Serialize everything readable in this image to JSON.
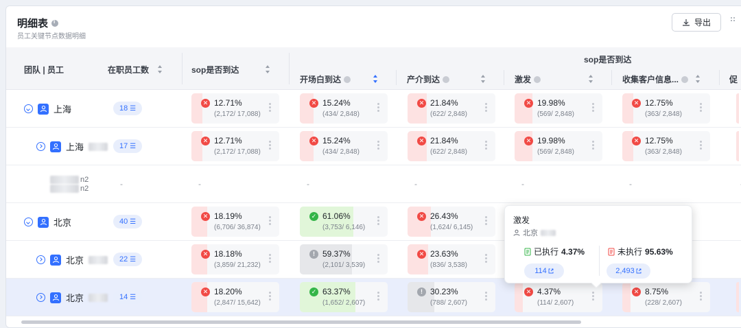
{
  "header": {
    "title": "明细表",
    "subtitle": "员工关键节点数据明细",
    "export_label": "导出"
  },
  "columns": {
    "team": "团队 | 员工",
    "employees": "在职员工数",
    "sop_arrival": "sop是否到达",
    "group_title": "sop是否到达",
    "opening": "开场白到达",
    "product": "产介到达",
    "motivate": "激发",
    "collect": "收集客户信息...",
    "cut": "促"
  },
  "rows": [
    {
      "team": "上海",
      "emp": "18",
      "level": 0,
      "metrics": [
        {
          "pct": "12.71%",
          "frac": "(2,172/ 17,088)",
          "status": "fail",
          "value": 0.1271
        },
        {
          "pct": "15.24%",
          "frac": "(434/ 2,848)",
          "status": "fail",
          "value": 0.1524
        },
        {
          "pct": "21.84%",
          "frac": "(622/ 2,848)",
          "status": "fail",
          "value": 0.2184
        },
        {
          "pct": "19.98%",
          "frac": "(569/ 2,848)",
          "status": "fail",
          "value": 0.1998
        },
        {
          "pct": "12.75%",
          "frac": "(363/ 2,848)",
          "status": "fail",
          "value": 0.1275
        }
      ]
    },
    {
      "team": "上海",
      "emp": "17",
      "level": 1,
      "metrics": [
        {
          "pct": "12.71%",
          "frac": "(2,172/ 17,088)",
          "status": "fail",
          "value": 0.1271
        },
        {
          "pct": "15.24%",
          "frac": "(434/ 2,848)",
          "status": "fail",
          "value": 0.1524
        },
        {
          "pct": "21.84%",
          "frac": "(622/ 2,848)",
          "status": "fail",
          "value": 0.2184
        },
        {
          "pct": "19.98%",
          "frac": "(569/ 2,848)",
          "status": "fail",
          "value": 0.1998
        },
        {
          "pct": "12.75%",
          "frac": "(363/ 2,848)",
          "status": "fail",
          "value": 0.1275
        }
      ]
    },
    {
      "team": "",
      "line1": "n2",
      "line2": "n2",
      "emp": "-",
      "level": 2,
      "dash": "-"
    },
    {
      "team": "北京",
      "emp": "40",
      "level": 0,
      "metrics": [
        {
          "pct": "18.19%",
          "frac": "(6,706/ 36,874)",
          "status": "fail",
          "value": 0.1819
        },
        {
          "pct": "61.06%",
          "frac": "(3,753/ 6,146)",
          "status": "pass",
          "value": 0.6106
        },
        {
          "pct": "26.43%",
          "frac": "(1,624/ 6,145)",
          "status": "fail",
          "value": 0.2643
        }
      ]
    },
    {
      "team": "北京",
      "emp": "22",
      "level": 1,
      "metrics": [
        {
          "pct": "18.18%",
          "frac": "(3,859/ 21,232)",
          "status": "fail",
          "value": 0.1818
        },
        {
          "pct": "59.37%",
          "frac": "(2,101/ 3,539)",
          "status": "neutral",
          "value": 0.5937
        },
        {
          "pct": "23.63%",
          "frac": "(836/ 3,538)",
          "status": "fail",
          "value": 0.2363
        }
      ]
    },
    {
      "team": "北京",
      "emp": "14",
      "level": 1,
      "selected": true,
      "metrics": [
        {
          "pct": "18.20%",
          "frac": "(2,847/ 15,642)",
          "status": "fail",
          "value": 0.182
        },
        {
          "pct": "63.37%",
          "frac": "(1,652/ 2,607)",
          "status": "pass",
          "value": 0.6337
        },
        {
          "pct": "30.23%",
          "frac": "(788/ 2,607)",
          "status": "neutral",
          "value": 0.3023
        },
        {
          "pct": "4.37%",
          "frac": "(114/ 2,607)",
          "status": "fail",
          "value": 0.0437
        },
        {
          "pct": "8.75%",
          "frac": "(228/ 2,607)",
          "status": "fail",
          "value": 0.0875
        }
      ]
    }
  ],
  "tooltip": {
    "title": "激发",
    "team": "北京",
    "done_label": "已执行",
    "done_pct": "4.37%",
    "done_count": "114",
    "undone_label": "未执行",
    "undone_pct": "95.63%",
    "undone_count": "2,493"
  },
  "icons": {
    "export": "download-icon",
    "team": "group-icon",
    "expand": "chevron-circle-icon",
    "fail": "x-circle-icon",
    "pass": "check-circle-icon",
    "neutral": "info-circle-icon",
    "more": "more-vertical-icon",
    "sort": "sort-icon",
    "link": "external-link-icon"
  },
  "colors": {
    "accent": "#3370ff",
    "fail": "#f14a45",
    "pass": "#34b548",
    "neutral": "#a3a7ae"
  }
}
